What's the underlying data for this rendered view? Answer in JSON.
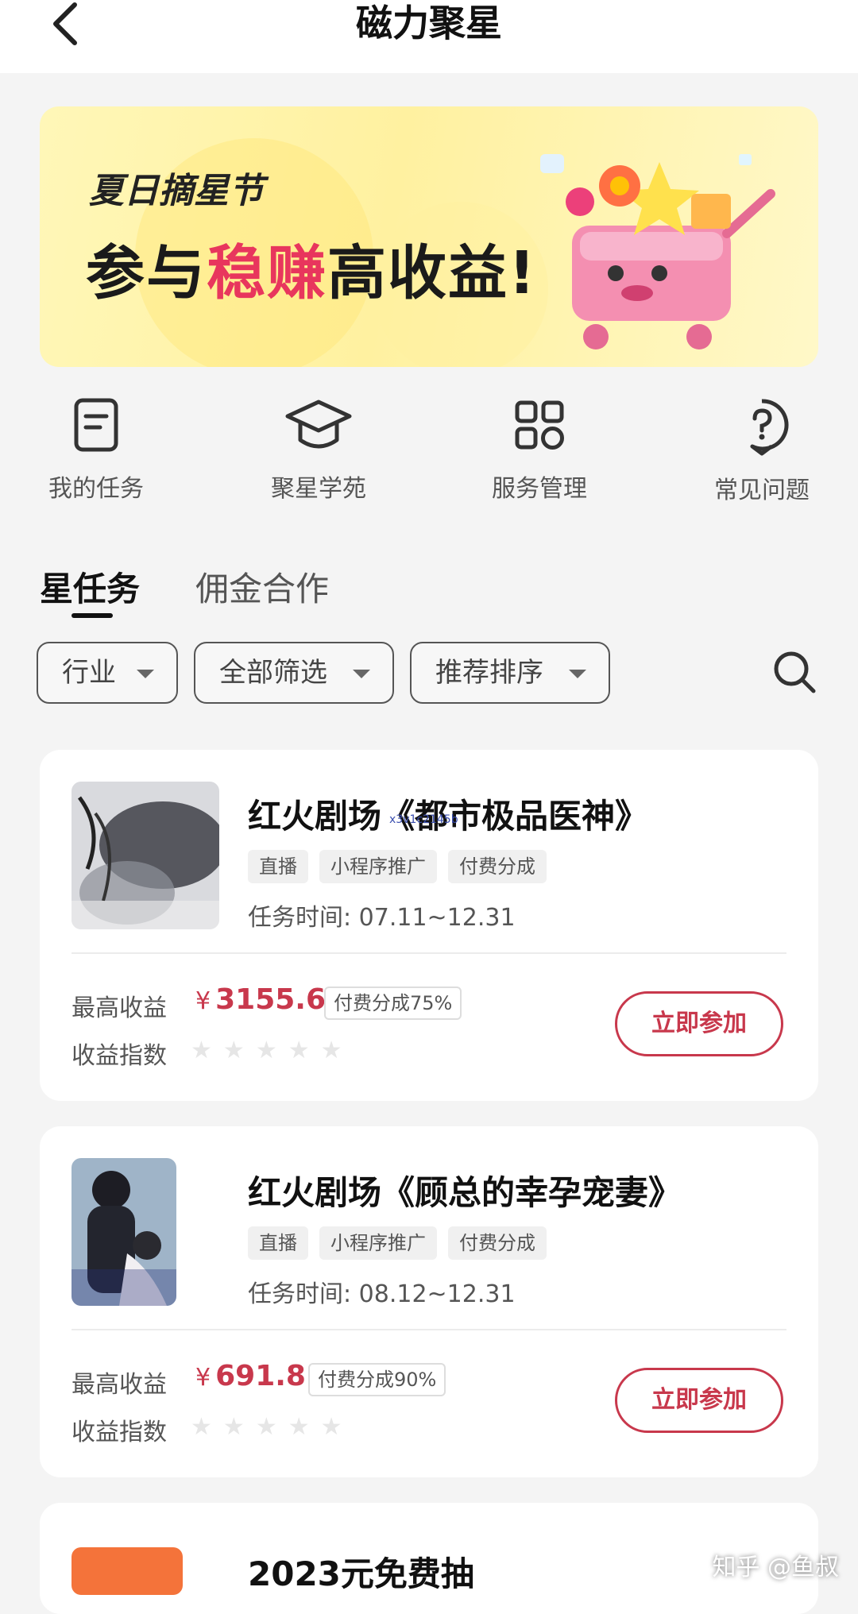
{
  "header": {
    "title": "磁力聚星"
  },
  "banner": {
    "subtitle": "夏日摘星节",
    "title_pre": "参与",
    "title_highlight": "稳赚",
    "title_post": "高收益!"
  },
  "quick_menu": [
    {
      "label": "我的任务",
      "icon": "task-doc-icon"
    },
    {
      "label": "聚星学苑",
      "icon": "graduation-cap-icon"
    },
    {
      "label": "服务管理",
      "icon": "grid-icon"
    },
    {
      "label": "常见问题",
      "icon": "question-bubble-icon"
    }
  ],
  "tabs": [
    {
      "label": "星任务",
      "active": true
    },
    {
      "label": "佣金合作",
      "active": false
    }
  ],
  "filters": [
    {
      "label": "行业"
    },
    {
      "label": "全部筛选"
    },
    {
      "label": "推荐排序"
    }
  ],
  "cards": [
    {
      "title": "红火剧场《都市极品医神》",
      "tags": [
        "直播",
        "小程序推广",
        "付费分成"
      ],
      "time": "任务时间: 07.11~12.31",
      "income_label": "最高收益",
      "currency": "¥",
      "amount": "3155.6",
      "share": "付费分成75%",
      "index_label": "收益指数",
      "rating": 0,
      "button": "立即参加",
      "overlay": "x3v1c2145b"
    },
    {
      "title": "红火剧场《顾总的幸孕宠妻》",
      "tags": [
        "直播",
        "小程序推广",
        "付费分成"
      ],
      "time": "任务时间: 08.12~12.31",
      "income_label": "最高收益",
      "currency": "¥",
      "amount": "691.8",
      "share": "付费分成90%",
      "index_label": "收益指数",
      "rating": 0,
      "button": "立即参加"
    },
    {
      "title": "2023元免费抽"
    }
  ],
  "watermark": "知乎 @鱼叔",
  "colors": {
    "accent": "#c8384c",
    "banner_highlight": "#e8365d"
  }
}
